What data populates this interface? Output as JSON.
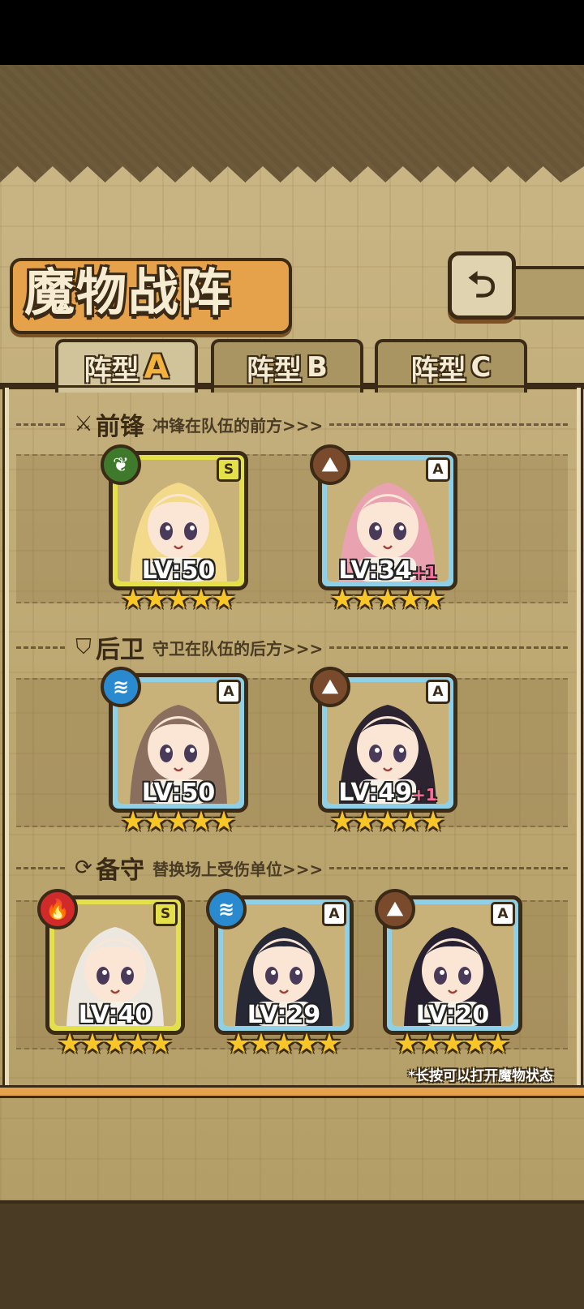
{
  "header": {
    "title": "魔物战阵",
    "back_icon": "return-arrow-icon"
  },
  "tabs": [
    {
      "label": "阵型",
      "letter": "A",
      "selected": true
    },
    {
      "label": "阵型",
      "letter": "B",
      "selected": false
    },
    {
      "label": "阵型",
      "letter": "C",
      "selected": false
    }
  ],
  "sections": {
    "front": {
      "icon": "sword-icon",
      "name": "前锋",
      "desc": "冲锋在队伍的前方>>>"
    },
    "rear": {
      "icon": "shield-icon",
      "name": "后卫",
      "desc": "守卫在队伍的后方>>>"
    },
    "reserve": {
      "icon": "swap-icon",
      "name": "备守",
      "desc": "替换场上受伤单位>>>"
    }
  },
  "units": {
    "front": [
      {
        "rank": "S",
        "element": "nature",
        "level": "LV:50",
        "bonus": "",
        "stars": 5,
        "colors": {
          "hair": "#f3d98a",
          "skin": "#fbe6d6"
        }
      },
      {
        "rank": "A",
        "element": "earth",
        "level": "LV:34",
        "bonus": "+1",
        "stars": 5,
        "colors": {
          "hair": "#e9a2b0",
          "skin": "#fbe6d6"
        }
      }
    ],
    "rear": [
      {
        "rank": "A",
        "element": "water",
        "level": "LV:50",
        "bonus": "",
        "stars": 5,
        "colors": {
          "hair": "#8a6f5e",
          "skin": "#fbe6d6"
        }
      },
      {
        "rank": "A",
        "element": "earth",
        "level": "LV:49",
        "bonus": "+1",
        "stars": 5,
        "colors": {
          "hair": "#2c2430",
          "skin": "#fbe6d6"
        }
      }
    ],
    "reserve": [
      {
        "rank": "S",
        "element": "fire",
        "level": "LV:40",
        "bonus": "",
        "stars": 5,
        "colors": {
          "hair": "#ece8df",
          "skin": "#fbe6d6"
        }
      },
      {
        "rank": "A",
        "element": "water",
        "level": "LV:29",
        "bonus": "",
        "stars": 5,
        "colors": {
          "hair": "#262836",
          "skin": "#fbe6d6"
        }
      },
      {
        "rank": "A",
        "element": "earth",
        "level": "LV:20",
        "bonus": "",
        "stars": 5,
        "colors": {
          "hair": "#262030",
          "skin": "#fbe6d6"
        }
      }
    ]
  },
  "hint": "*长按可以打开魔物状态",
  "element_icons": {
    "nature": "leaf-icon",
    "earth": "mountain-icon",
    "water": "water-wave-icon",
    "fire": "flame-icon"
  }
}
